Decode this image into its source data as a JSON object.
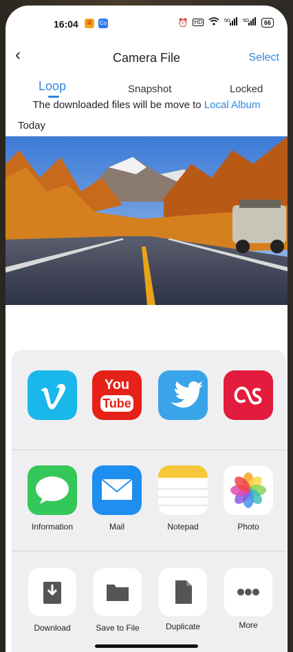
{
  "status": {
    "time": "16:04",
    "battery": "66"
  },
  "nav": {
    "back": "‹",
    "title": "Camera File",
    "select": "Select"
  },
  "tabs": [
    {
      "label": "Loop"
    },
    {
      "label": "Snapshot"
    },
    {
      "label": "Locked"
    }
  ],
  "notice": {
    "text": "The downloaded files will be move to ",
    "link": "Local Album"
  },
  "section": {
    "title": "Today"
  },
  "share": {
    "apps": [
      {
        "icon": "vimeo-icon"
      },
      {
        "icon": "youtube-icon",
        "text1": "You",
        "text2": "Tube"
      },
      {
        "icon": "twitter-icon"
      },
      {
        "icon": "lastfm-icon"
      }
    ],
    "apps2": [
      {
        "icon": "messages-icon",
        "label": "Information"
      },
      {
        "icon": "mail-icon",
        "label": "Mail"
      },
      {
        "icon": "notes-icon",
        "label": "Notepad"
      },
      {
        "icon": "photos-icon",
        "label": "Photo"
      }
    ],
    "actions": [
      {
        "icon": "download-icon",
        "label": "Download"
      },
      {
        "icon": "folder-icon",
        "label": "Save to File"
      },
      {
        "icon": "document-icon",
        "label": "Duplicate"
      },
      {
        "icon": "more-icon",
        "label": "More"
      }
    ]
  }
}
